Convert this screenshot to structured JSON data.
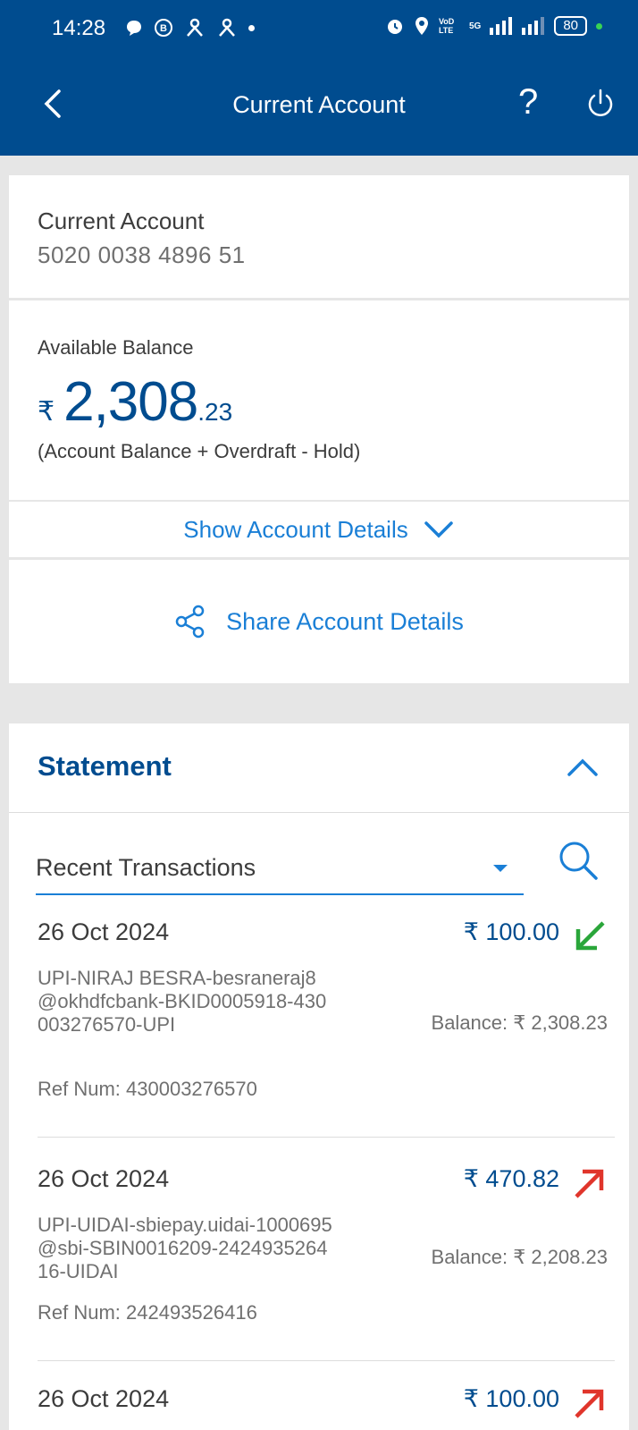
{
  "status_bar": {
    "time": "14:28",
    "battery": "80",
    "network": "5G",
    "volte": "VoD LTE"
  },
  "header": {
    "title": "Current Account",
    "help": "?"
  },
  "account": {
    "type": "Current Account",
    "number": "5020 0038 4896 51"
  },
  "balance": {
    "label": "Available Balance",
    "currency": "₹",
    "integer": "2,308",
    "decimal": ".23",
    "note": "(Account Balance + Overdraft - Hold)"
  },
  "actions": {
    "show_details": "Show Account Details",
    "share_details": "Share Account Details"
  },
  "statement": {
    "title": "Statement",
    "filter": "Recent Transactions",
    "transactions": [
      {
        "date": "26 Oct 2024",
        "amount": "₹ 100.00",
        "direction": "credit",
        "description": "UPI-NIRAJ BESRA-besraneraj8@okhdfcbank-BKID0005918-430003276570-UPI",
        "balance": "Balance: ₹ 2,308.23",
        "ref": "Ref Num: 430003276570"
      },
      {
        "date": "26 Oct 2024",
        "amount": "₹ 470.82",
        "direction": "debit",
        "description": "UPI-UIDAI-sbiepay.uidai-1000695@sbi-SBIN0016209-242493526416-UIDAI",
        "balance": "Balance: ₹ 2,208.23",
        "ref": "Ref Num: 242493526416"
      },
      {
        "date": "26 Oct 2024",
        "amount": "₹ 100.00",
        "direction": "debit"
      }
    ]
  },
  "colors": {
    "brand": "#004c8f",
    "link": "#1a7fd6",
    "credit": "#2aa63a",
    "debit": "#e0352b"
  }
}
